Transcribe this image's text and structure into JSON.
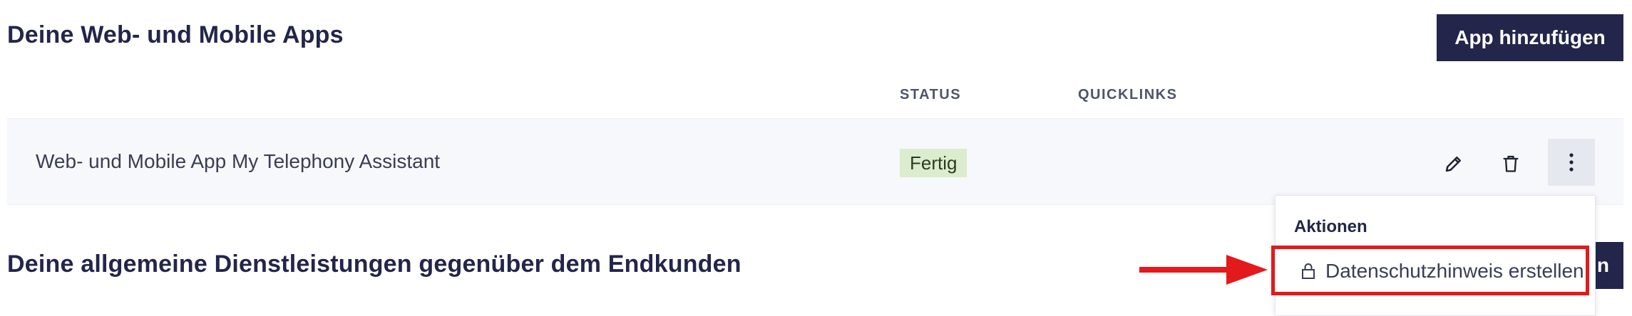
{
  "sections": {
    "apps": {
      "title": "Deine Web- und Mobile Apps",
      "add_button": "App hinzufügen"
    },
    "services": {
      "title": "Deine allgemeine Dienstleistungen gegenüber dem Endkunden",
      "button_visible_text": "n"
    }
  },
  "table": {
    "headers": {
      "status": "STATUS",
      "quicklinks": "QUICKLINKS"
    },
    "rows": [
      {
        "name": "Web- und Mobile App My Telephony Assistant",
        "status": "Fertig",
        "actions": [
          "pencil-icon",
          "trash-icon",
          "more-vertical-icon"
        ]
      }
    ]
  },
  "menu": {
    "heading": "Aktionen",
    "items": [
      {
        "label": "Datenschutzhinweis erstellen",
        "icon": "lock-icon"
      }
    ]
  },
  "annotation": {
    "color": "#e4191b",
    "target": "menu.items.0"
  },
  "colors": {
    "primary": "#23264a",
    "status_badge_bg": "#dbeccf",
    "row_bg": "#f7f8fb",
    "more_button_bg": "#e5e8ef"
  }
}
